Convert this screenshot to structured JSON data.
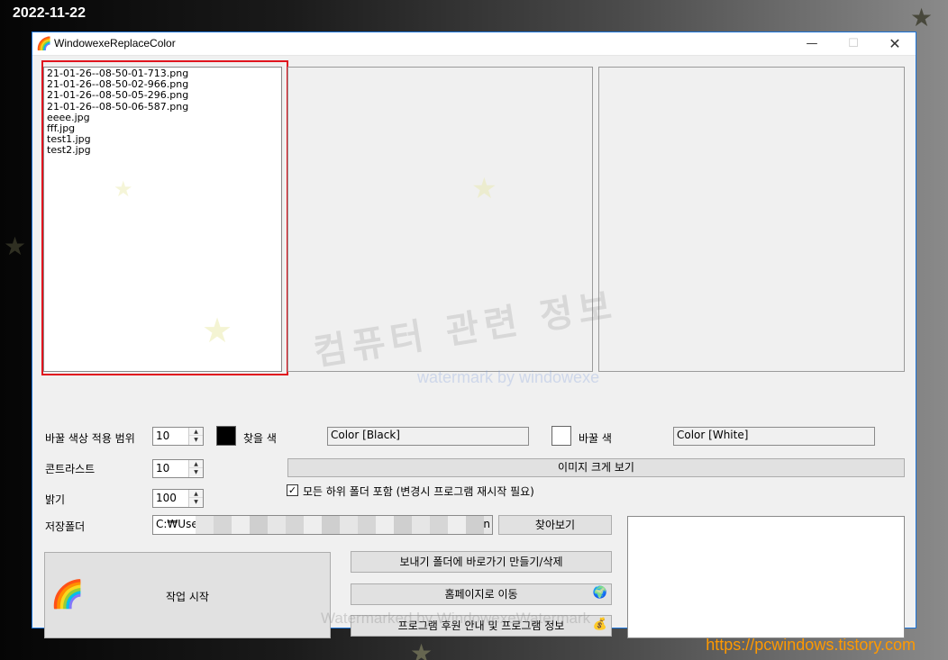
{
  "desktop": {
    "date": "2022-11-22",
    "url": "https://pcwindows.tistory.com"
  },
  "window": {
    "title": "WindowexeReplaceColor",
    "icon": "rainbow-icon",
    "controls": {
      "minimize": "—",
      "maximize": "☐",
      "close": "✕"
    }
  },
  "file_list": [
    "21-01-26--08-50-01-713.png",
    "21-01-26--08-50-02-966.png",
    "21-01-26--08-50-05-296.png",
    "21-01-26--08-50-06-587.png",
    "eeee.jpg",
    "fff.jpg",
    "test1.jpg",
    "test2.jpg"
  ],
  "watermarks": {
    "korean": "컴퓨터 관련 정보",
    "english": "watermark by windowexe",
    "bottom": "Watermarked by WindowexeWatermark"
  },
  "settings": {
    "range_label": "바꿀 색상 적용 범위",
    "range_value": "10",
    "find_color_label": "찾을 색",
    "find_color_value": "Color [Black]",
    "find_color_hex": "#000000",
    "replace_color_label": "바꿀 색",
    "replace_color_value": "Color [White]",
    "replace_color_hex": "#ffffff",
    "contrast_label": "콘트라스트",
    "contrast_value": "10",
    "brightness_label": "밝기",
    "brightness_value": "100",
    "view_large_button": "이미지 크게 보기",
    "include_subfolders_label": "모든 하위 폴더 포함 (변경시 프로그램 재시작 필요)",
    "include_subfolders_checked": true,
    "save_folder_label": "저장폴더",
    "save_folder_prefix": "C:₩Use",
    "save_folder_suffix": "n",
    "browse_button": "찾아보기"
  },
  "actions": {
    "start": "작업 시작",
    "sendto_shortcut": "보내기 폴더에 바로가기 만들기/삭제",
    "homepage": "홈페이지로 이동",
    "support_info": "프로그램 후원 안내 및 프로그램 정보"
  }
}
